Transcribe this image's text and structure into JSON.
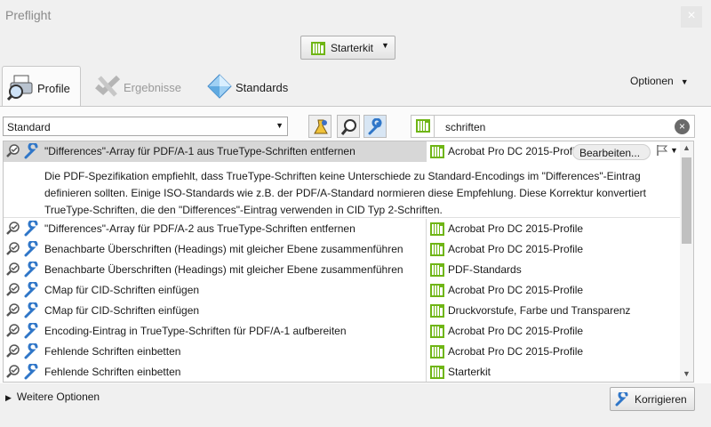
{
  "window": {
    "title": "Preflight",
    "close_symbol": "×"
  },
  "toolbar": {
    "library_button": "Starterkit"
  },
  "tabs": [
    {
      "label": "Profile",
      "icon": "printer-magnifier-icon",
      "active": true
    },
    {
      "label": "Ergebnisse",
      "icon": "results-icon",
      "active": false,
      "disabled": true
    },
    {
      "label": "Standards",
      "icon": "diamond-icon",
      "active": false
    }
  ],
  "options_menu": {
    "label": "Optionen"
  },
  "filter": {
    "dropdown_value": "Standard"
  },
  "search": {
    "value": "schriften",
    "clear_symbol": "×"
  },
  "rows": [
    {
      "name": "\"Differences\"-Array für PDF/A-1 aus TrueType-Schriften entfernen",
      "group": "Acrobat Pro DC 2015-Profile",
      "selected": true,
      "edit_button": "Bearbeiten..."
    },
    {
      "name": "\"Differences\"-Array für PDF/A-2 aus TrueType-Schriften entfernen",
      "group": "Acrobat Pro DC 2015-Profile"
    },
    {
      "name": "Benachbarte Überschriften (Headings) mit gleicher Ebene zusammenführen",
      "group": "Acrobat Pro DC 2015-Profile"
    },
    {
      "name": "Benachbarte Überschriften (Headings) mit gleicher Ebene zusammenführen",
      "group": "PDF-Standards"
    },
    {
      "name": "CMap für CID-Schriften einfügen",
      "group": "Acrobat Pro DC 2015-Profile"
    },
    {
      "name": "CMap für CID-Schriften einfügen",
      "group": "Druckvorstufe, Farbe und Transparenz"
    },
    {
      "name": "Encoding-Eintrag in TrueType-Schriften für PDF/A-1 aufbereiten",
      "group": "Acrobat Pro DC 2015-Profile"
    },
    {
      "name": "Fehlende Schriften einbetten",
      "group": "Acrobat Pro DC 2015-Profile"
    },
    {
      "name": "Fehlende Schriften einbetten",
      "group": "Starterkit"
    }
  ],
  "selected_description": "Die PDF-Spezifikation empfiehlt, dass TrueType-Schriften keine Unterschiede zu Standard-Encodings im \"Differences\"-Eintrag definieren sollten. Einige ISO-Standards wie z.B. der PDF/A-Standard normieren diese Empfehlung. Diese Korrektur konvertiert TrueType-Schriften, die den \"Differences\"-Eintrag verwenden in CID Typ 2-Schriften.",
  "footer": {
    "more_options": "Weitere Optionen",
    "fix_button": "Korrigieren"
  },
  "colors": {
    "library_green": "#6fb515",
    "wrench_blue": "#2f76c8",
    "selection_gray": "#d7d7d7"
  }
}
